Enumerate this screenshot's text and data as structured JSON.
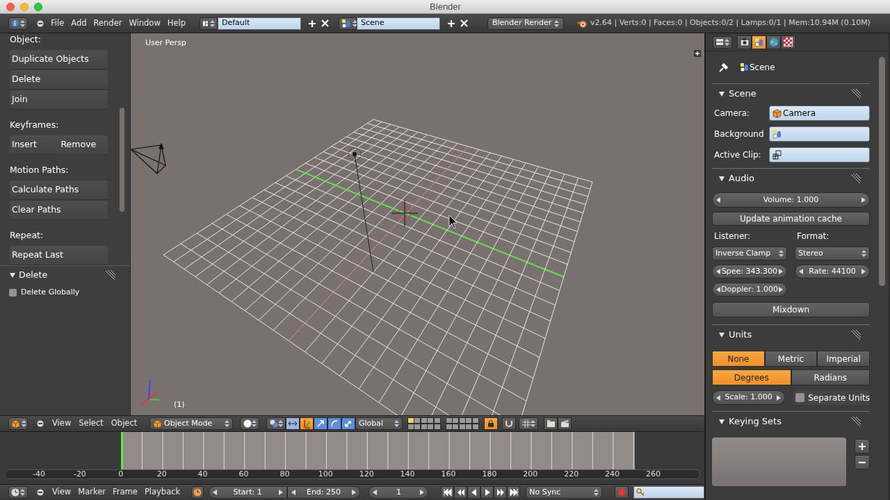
{
  "window": {
    "title": "Blender"
  },
  "info_header": {
    "menus": [
      "File",
      "Add",
      "Render",
      "Window",
      "Help"
    ],
    "screen_layout": "Default",
    "scene": "Scene",
    "render_engine": "Blender Render",
    "stats": "v2.64 | Verts:0 | Faces:0 | Objects:0/2 | Lamps:0/1 | Mem:10.94M (0.10M)"
  },
  "tool_shelf": {
    "sections": [
      {
        "heading": "Object:",
        "rows": [
          [
            "Duplicate Objects"
          ],
          [
            "Delete"
          ],
          [
            "Join"
          ]
        ]
      },
      {
        "heading": "Keyframes:",
        "rows": [
          [
            "Insert",
            "Remove"
          ]
        ]
      },
      {
        "heading": "Motion Paths:",
        "rows": [
          [
            "Calculate Paths"
          ],
          [
            "Clear Paths"
          ]
        ]
      },
      {
        "heading": "Repeat:",
        "rows": [
          [
            "Repeat Last"
          ]
        ]
      }
    ]
  },
  "operator_panel": {
    "title": "Delete",
    "expanded": true,
    "options": [
      {
        "label": "Delete Globally",
        "checked": false
      }
    ]
  },
  "viewport": {
    "view_label": "User Persp",
    "frame_label": "(1)"
  },
  "viewport_header": {
    "menus": [
      "View",
      "Select",
      "Object"
    ],
    "mode": "Object Mode",
    "orientation": "Global"
  },
  "timeline": {
    "ticks": [
      "-40",
      "-20",
      "0",
      "20",
      "40",
      "60",
      "80",
      "100",
      "120",
      "140",
      "160",
      "180",
      "200",
      "220",
      "240",
      "260"
    ]
  },
  "timeline_header": {
    "menus": [
      "View",
      "Marker",
      "Frame",
      "Playback"
    ],
    "start": "Start: 1",
    "end": "End: 250",
    "current_frame": "1",
    "sync": "No Sync"
  },
  "properties": {
    "tabs": [
      {
        "kind": "render",
        "selected": false
      },
      {
        "kind": "scene",
        "selected": true
      },
      {
        "kind": "world",
        "selected": false
      },
      {
        "kind": "texture",
        "selected": false
      }
    ],
    "breadcrumb": "Scene",
    "scene_panel": {
      "title": "Scene",
      "expanded": true,
      "fields": [
        {
          "label": "Camera:",
          "value": "Camera",
          "kind": "camera"
        },
        {
          "label": "Background",
          "kind": "scene"
        },
        {
          "label": "Active Clip:",
          "kind": "clip"
        }
      ]
    },
    "audio_panel": {
      "title": "Audio",
      "expanded": true,
      "volume": "Volume: 1.000",
      "cache_button": "Update animation cache",
      "listener_label": "Listener:",
      "format_label": "Format:",
      "listener": "Inverse Clamp",
      "format": "Stereo",
      "speed": "Spee: 343.300",
      "rate": "Rate: 44100",
      "doppler": "Doppler: 1.000",
      "mixdown": "Mixdown"
    },
    "units_panel": {
      "title": "Units",
      "expanded": true,
      "systems": [
        {
          "label": "None",
          "selected": true
        },
        {
          "label": "Metric",
          "selected": false
        },
        {
          "label": "Imperial",
          "selected": false
        }
      ],
      "rotation": [
        {
          "label": "Degrees",
          "selected": true
        },
        {
          "label": "Radians",
          "selected": false
        }
      ],
      "scale": "Scale: 1.000",
      "separate_units": {
        "label": "Separate Units",
        "checked": false
      }
    },
    "keying_sets_panel": {
      "title": "Keying Sets",
      "expanded": true
    }
  }
}
